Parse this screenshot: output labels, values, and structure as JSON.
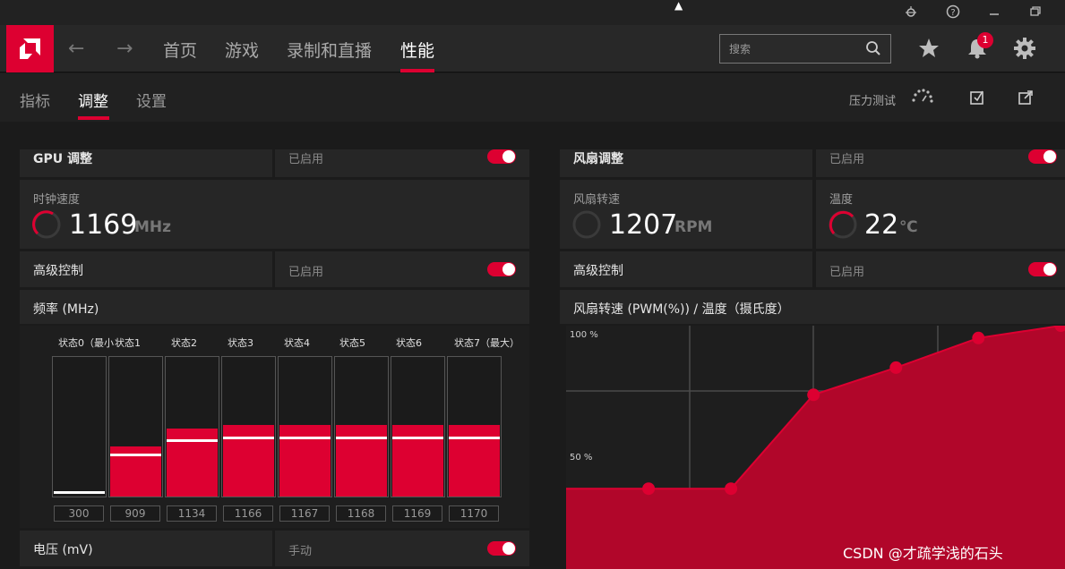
{
  "navbar": {
    "tabs": [
      {
        "label": "首页"
      },
      {
        "label": "游戏"
      },
      {
        "label": "录制和直播"
      },
      {
        "label": "性能"
      }
    ],
    "active_tab": "性能",
    "search_placeholder": "搜索",
    "notification_count": "1"
  },
  "subnav": {
    "tabs": [
      {
        "label": "指标"
      },
      {
        "label": "调整"
      },
      {
        "label": "设置"
      }
    ],
    "active_tab": "调整",
    "stress_test_label": "压力测试"
  },
  "gpu": {
    "section_title": "GPU 调整",
    "section_status": "已启用",
    "clock_label": "时钟速度",
    "clock_value": "1169",
    "clock_unit": "MHz",
    "advanced_label": "高级控制",
    "advanced_status": "已启用",
    "freq_title": "频率 (MHz)",
    "voltage_label": "电压 (mV)",
    "voltage_status": "手动",
    "states": [
      {
        "label": "状态0（最小",
        "value": "300",
        "fill": 0.0,
        "mark": 0.02
      },
      {
        "label": "状态1",
        "value": "909",
        "fill": 0.36,
        "mark": 0.29
      },
      {
        "label": "状态2",
        "value": "1134",
        "fill": 0.49,
        "mark": 0.39
      },
      {
        "label": "状态3",
        "value": "1166",
        "fill": 0.51,
        "mark": 0.41
      },
      {
        "label": "状态4",
        "value": "1167",
        "fill": 0.51,
        "mark": 0.41
      },
      {
        "label": "状态5",
        "value": "1168",
        "fill": 0.51,
        "mark": 0.41
      },
      {
        "label": "状态6",
        "value": "1169",
        "fill": 0.51,
        "mark": 0.41
      },
      {
        "label": "状态7（最大）",
        "value": "1170",
        "fill": 0.51,
        "mark": 0.41
      }
    ]
  },
  "fan": {
    "section_title": "风扇调整",
    "section_status": "已启用",
    "speed_label": "风扇转速",
    "speed_value": "1207",
    "speed_unit": "RPM",
    "temp_label": "温度",
    "temp_value": "22",
    "temp_unit": "℃",
    "advanced_label": "高级控制",
    "advanced_status": "已启用",
    "curve_title": "风扇转速 (PWM(%)) / 温度（摄氏度）"
  },
  "chart_data": {
    "type": "area",
    "title": "风扇转速 (PWM(%)) / 温度（摄氏度）",
    "ytick_labels": [
      "100 %",
      "50 %"
    ],
    "ylim": [
      0,
      100
    ],
    "points": [
      {
        "x": 1,
        "y": 34
      },
      {
        "x": 2,
        "y": 34
      },
      {
        "x": 3,
        "y": 72
      },
      {
        "x": 4,
        "y": 83
      },
      {
        "x": 5,
        "y": 95
      },
      {
        "x": 6,
        "y": 100
      }
    ],
    "xlim": [
      0,
      6.05
    ],
    "grid": true,
    "color": "#dd0031"
  },
  "watermark": "CSDN @才疏学浅的石头",
  "colors": {
    "accent": "#dd0031",
    "background": "#1b1b1b",
    "panel": "#262626"
  }
}
